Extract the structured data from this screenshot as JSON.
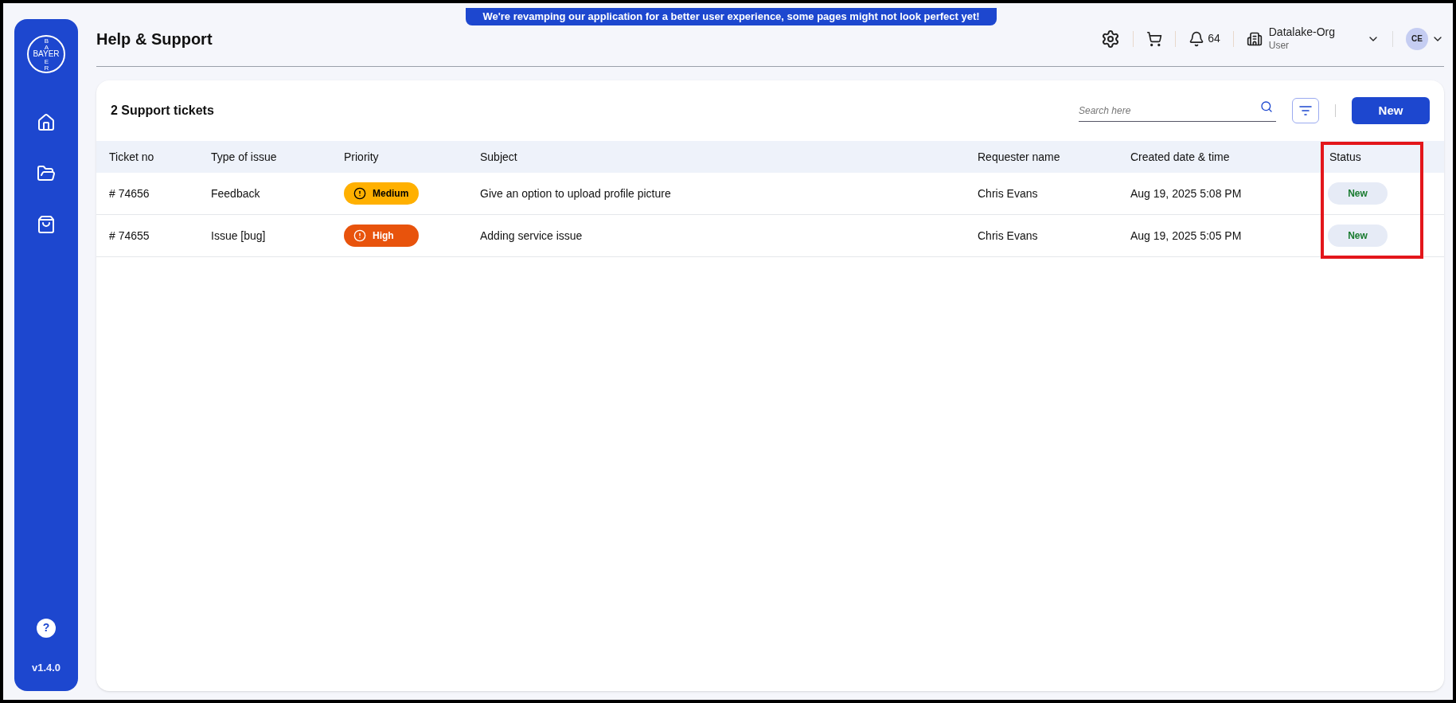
{
  "banner": "We're revamping our application for a better user experience, some pages might not look perfect yet!",
  "sidebar": {
    "logo": {
      "text": "BAYER",
      "vertical_top": "BA",
      "vertical_bottom": "ER"
    },
    "items": [
      {
        "kind": "home",
        "selected": false
      },
      {
        "kind": "folder",
        "selected": false
      },
      {
        "kind": "bag",
        "selected": false
      }
    ],
    "help": "?",
    "version": "v1.4.0"
  },
  "header": {
    "title": "Help & Support",
    "notifications": "64",
    "org": {
      "name": "Datalake-Org",
      "role": "User"
    },
    "avatar": "CE"
  },
  "card": {
    "title": "2 Support tickets",
    "search": {
      "placeholder": "Search here"
    },
    "new_button": "New"
  },
  "table": {
    "columns": [
      {
        "label": "Ticket no",
        "highlighted": false
      },
      {
        "label": "Type of issue",
        "highlighted": false
      },
      {
        "label": "Priority",
        "highlighted": false
      },
      {
        "label": "Subject",
        "highlighted": false
      },
      {
        "label": "Requester name",
        "highlighted": false
      },
      {
        "label": "Created date & time",
        "highlighted": false
      },
      {
        "label": "Status",
        "highlighted": true
      }
    ],
    "rows": [
      {
        "ticket": "# 74656",
        "type": "Feedback",
        "priority": {
          "label": "Medium",
          "kind": "medium"
        },
        "subject": "Give an option to upload profile picture",
        "requester": "Chris Evans",
        "created": "Aug 19, 2025 5:08 PM",
        "status": "New"
      },
      {
        "ticket": "# 74655",
        "type": "Issue [bug]",
        "priority": {
          "label": "High",
          "kind": "high"
        },
        "subject": "Adding service issue",
        "requester": "Chris Evans",
        "created": "Aug 19, 2025 5:05 PM",
        "status": "New"
      }
    ]
  }
}
